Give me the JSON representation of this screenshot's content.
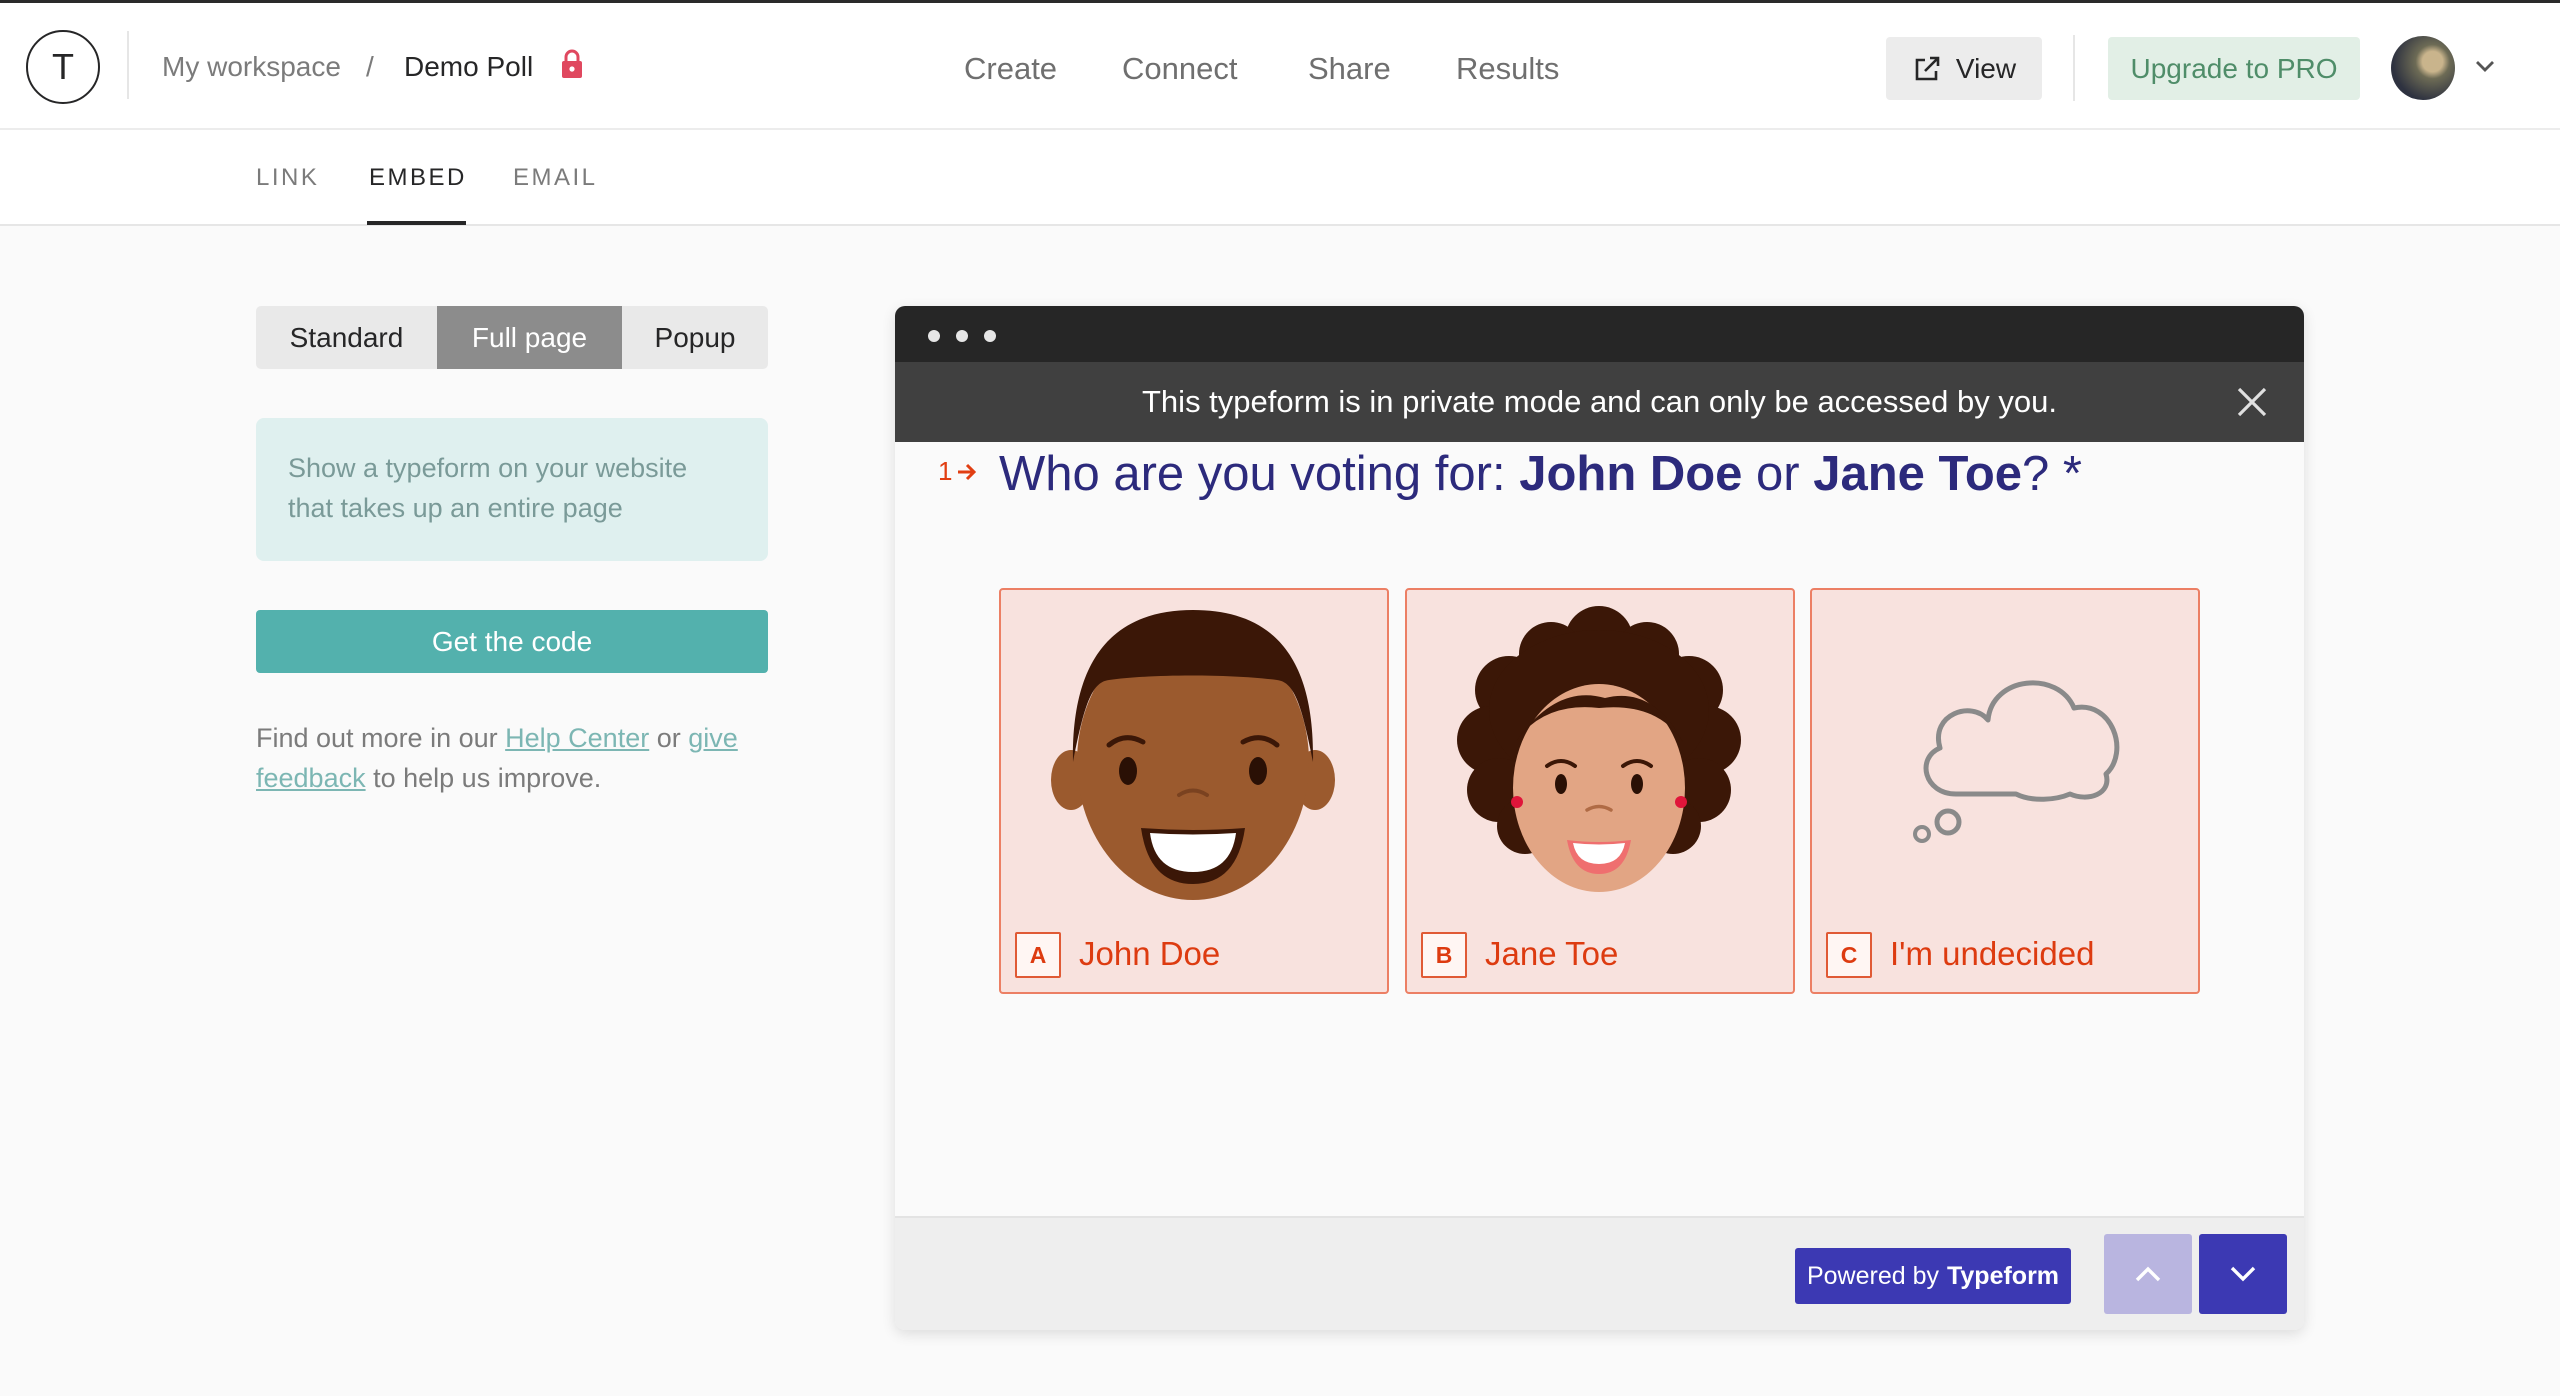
{
  "header": {
    "logo_letter": "T",
    "workspace": "My workspace",
    "separator": "/",
    "form_title": "Demo Poll",
    "nav": [
      "Create",
      "Connect",
      "Share",
      "Results"
    ],
    "view_label": "View",
    "upgrade_label": "Upgrade to PRO"
  },
  "subtabs": [
    "LINK",
    "EMBED",
    "EMAIL"
  ],
  "subtabs_active": "EMBED",
  "embed": {
    "modes": [
      "Standard",
      "Full page",
      "Popup"
    ],
    "active_mode": "Full page",
    "description": "Show a typeform on your website that takes up an entire page",
    "get_code_label": "Get the code",
    "help_prefix": "Find out more in our",
    "help_center_link": "Help Center",
    "help_or": "or",
    "feedback_link": "give feedback",
    "help_suffix": "to help us improve."
  },
  "preview": {
    "notice": "This typeform is in private mode and can only be accessed by you.",
    "question_number": "1",
    "question_prefix": "Who are you voting for: ",
    "candidate_a": "John Doe",
    "question_or": " or ",
    "candidate_b": "Jane Toe",
    "question_suffix": "? *",
    "choices": [
      {
        "key": "A",
        "label": "John Doe"
      },
      {
        "key": "B",
        "label": "Jane Toe"
      },
      {
        "key": "C",
        "label": "I'm undecided"
      }
    ],
    "powered_by": "Powered by",
    "brand": "Typeform"
  },
  "colors": {
    "question": "#2c2a7c",
    "choice_accent": "#dd3b10",
    "choice_bg": "#f8e2de",
    "button_primary": "#3c39b3",
    "teal": "#53b1ad"
  }
}
